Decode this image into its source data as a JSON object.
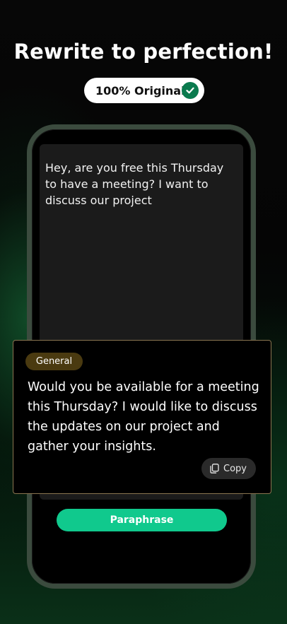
{
  "header": {
    "headline": "Rewrite to perfection!",
    "badge_label": "100% Original",
    "badge_icon": "check-circle-icon"
  },
  "input": {
    "text": "Hey, are you free this Thursday to have a meeting? I want to discuss our project"
  },
  "result": {
    "tag_label": "General",
    "text": "Would you be available for a meeting this Thursday? I would like to discuss the updates on our project and gather your insights.",
    "copy_label": "Copy",
    "copy_icon": "copy-icon"
  },
  "actions": {
    "paraphrase_label": "Paraphrase"
  },
  "colors": {
    "accent_green": "#10c98d",
    "badge_check": "#0a7a4e",
    "tag_background": "#4a3a10",
    "card_border": "#8a7550",
    "phone_frame": "#3b4b3e"
  }
}
